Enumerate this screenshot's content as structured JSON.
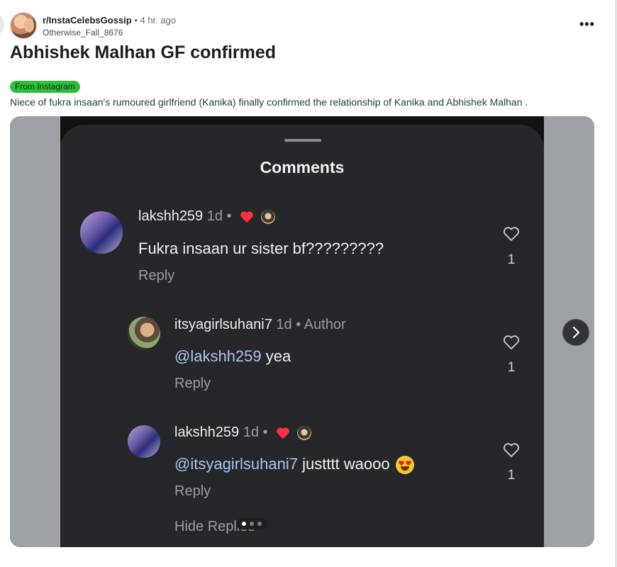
{
  "post": {
    "subreddit": "r/InstaCelebsGossip",
    "separator": "•",
    "time": "4 hr. ago",
    "author": "Otherwise_Fall_8676",
    "more_label": "•••",
    "title": "Abhishek Malhan GF confirmed",
    "flair": "From Instagram",
    "body": "Niece of fukra insaan's rumoured girlfriend (Kanika) finally confirmed the relationship of Kanika and Abhishek Malhan ."
  },
  "screenshot": {
    "header": "Comments",
    "comments": [
      {
        "user": "lakshh259",
        "meta": "1d •",
        "text": "Fukra insaan ur sister bf?????????",
        "reply": "Reply",
        "likes": "1"
      },
      {
        "user": "itsyagirlsuhani7",
        "meta": "1d • Author",
        "mention": "@lakshh259",
        "text": " yea",
        "reply": "Reply",
        "likes": "1"
      },
      {
        "user": "lakshh259",
        "meta": "1d •",
        "mention": "@itsyagirlsuhani7",
        "text": "  justttt waooo",
        "reply": "Reply",
        "likes": "1"
      }
    ],
    "hide_replies": "Hide Replies"
  },
  "gallery": {
    "page_count": 3,
    "current_page": 1
  },
  "colors": {
    "flair_bg": "#2fbf3a",
    "panel_bg": "#26272b",
    "mention": "#a9c4ef",
    "heart_red": "#ff3040"
  },
  "icons": [
    "more-icon",
    "heart-outline-icon",
    "red-heart-icon",
    "chevron-right-icon",
    "heart-eyes-emoji-icon"
  ]
}
